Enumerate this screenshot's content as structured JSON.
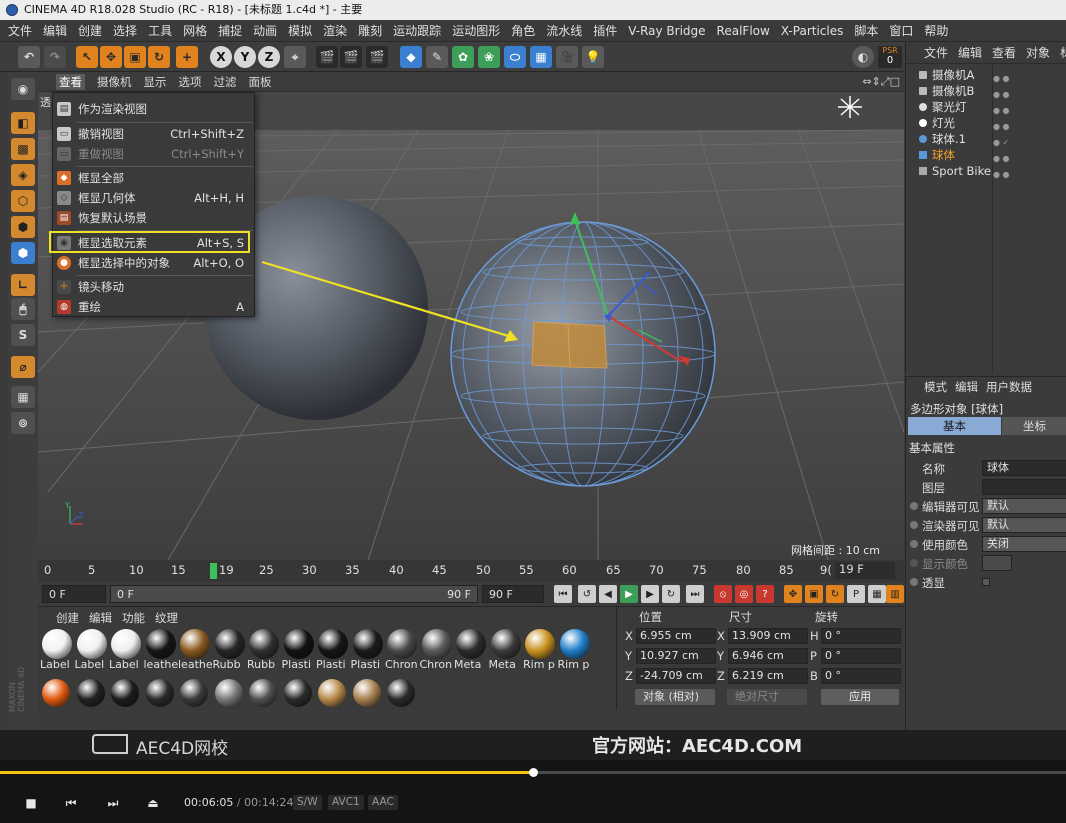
{
  "window": {
    "title": "CINEMA 4D R18.028 Studio (RC - R18) - [未标题 1.c4d *] - 主要"
  },
  "menubar": [
    "文件",
    "编辑",
    "创建",
    "选择",
    "工具",
    "网格",
    "捕捉",
    "动画",
    "模拟",
    "渲染",
    "雕刻",
    "运动跟踪",
    "运动图形",
    "角色",
    "流水线",
    "插件",
    "V-Ray Bridge",
    "RealFlow",
    "X-Particles",
    "脚本",
    "窗口",
    "帮助"
  ],
  "toolbar": {
    "undo_icon": "undo-icon",
    "psr_label": "PSR",
    "psr_value": "0",
    "x_label": "X",
    "y_label": "Y",
    "z_label": "Z"
  },
  "viewport": {
    "menu": [
      "查看",
      "摄像机",
      "显示",
      "选项",
      "过滤",
      "面板"
    ],
    "mode_label": "透",
    "grid_spacing": "网格间距 : 10 cm",
    "nav_icons": "⇔⇕⤢□"
  },
  "view_menu": {
    "items": [
      {
        "label": "作为渲染视图",
        "shortcut": "",
        "icon": "render-view-icon",
        "disabled": false
      },
      {
        "label": "撤销视图",
        "shortcut": "Ctrl+Shift+Z",
        "icon": "undo-view-icon",
        "disabled": false
      },
      {
        "label": "重做视图",
        "shortcut": "Ctrl+Shift+Y",
        "icon": "redo-view-icon",
        "disabled": true
      },
      {
        "label": "框显全部",
        "shortcut": "",
        "icon": "frame-all-icon",
        "disabled": false
      },
      {
        "label": "框显几何体",
        "shortcut": "Alt+H, H",
        "icon": "frame-geometry-icon",
        "disabled": false
      },
      {
        "label": "恢复默认场景",
        "shortcut": "",
        "icon": "restore-scene-icon",
        "disabled": false
      },
      {
        "label": "框显选取元素",
        "shortcut": "Alt+S, S",
        "icon": "frame-selected-elements-icon",
        "disabled": false
      },
      {
        "label": "框显选择中的对象",
        "shortcut": "Alt+O, O",
        "icon": "frame-selected-objects-icon",
        "disabled": false
      },
      {
        "label": "镜头移动",
        "shortcut": "",
        "icon": "camera-move-icon",
        "disabled": false
      },
      {
        "label": "重绘",
        "shortcut": "A",
        "icon": "redraw-icon",
        "disabled": false
      }
    ]
  },
  "timeline": {
    "ticks": [
      "0",
      "5",
      "10",
      "15",
      "25",
      "30",
      "35",
      "40",
      "45",
      "50",
      "55",
      "60",
      "65",
      "70",
      "75",
      "80",
      "85",
      "9("
    ],
    "current_frame": "19",
    "end_field": "19 F"
  },
  "transport": {
    "start_field": "0 F",
    "range_start": "0 F",
    "range_end": "90 F",
    "end_field": "90 F"
  },
  "material_manager": {
    "menu": [
      "创建",
      "编辑",
      "功能",
      "纹理"
    ],
    "materials_row1": [
      {
        "label": "Label",
        "color": "#f2f2f2"
      },
      {
        "label": "Label",
        "color": "#f0f0f0"
      },
      {
        "label": "Label",
        "color": "#eeeeee"
      },
      {
        "label": "leathe",
        "color": "#161616"
      },
      {
        "label": "leathe",
        "color": "#8a5a1e"
      },
      {
        "label": "Rubb",
        "color": "#262626"
      },
      {
        "label": "Rubb",
        "color": "#303030"
      },
      {
        "label": "Plasti",
        "color": "#111111"
      },
      {
        "label": "Plasti",
        "color": "#151515"
      },
      {
        "label": "Plasti",
        "color": "#1a1a1a"
      },
      {
        "label": "Chron",
        "color": "#4a4a4a"
      },
      {
        "label": "Chron",
        "color": "#5a5a5a"
      },
      {
        "label": "Meta",
        "color": "#2c2c2c"
      },
      {
        "label": "Meta",
        "color": "#3a3a3a"
      },
      {
        "label": "Rim p",
        "color": "#c99220"
      },
      {
        "label": "Rim p",
        "color": "#1f7fc9"
      }
    ],
    "materials_row2": [
      "#e05a10",
      "#222222",
      "#1c1c1c",
      "#2a2a2a",
      "#3a3a3a",
      "#7a7a7a",
      "#505050",
      "#2a2a2a",
      "#b88a4a",
      "#a98050",
      "#2a2a2a"
    ]
  },
  "coordinates": {
    "headers": {
      "pos": "位置",
      "size": "尺寸",
      "rot": "旋转"
    },
    "rows": [
      {
        "axis": "X",
        "pos": "6.955 cm",
        "saxis": "X",
        "size": "13.909 cm",
        "raxis": "H",
        "rot": "0 °"
      },
      {
        "axis": "Y",
        "pos": "10.927 cm",
        "saxis": "Y",
        "size": "6.946 cm",
        "raxis": "P",
        "rot": "0 °"
      },
      {
        "axis": "Z",
        "pos": "-24.709 cm",
        "saxis": "Z",
        "size": "6.219 cm",
        "raxis": "B",
        "rot": "0 °"
      }
    ],
    "mode_dropdown": "对象 (相对)",
    "size_dropdown": "绝对尺寸",
    "apply_label": "应用"
  },
  "object_manager": {
    "menu": [
      "文件",
      "编辑",
      "查看",
      "对象",
      "标"
    ],
    "objects": [
      {
        "name": "摄像机A",
        "selected": false
      },
      {
        "name": "摄像机B",
        "selected": false
      },
      {
        "name": "聚光灯",
        "selected": false
      },
      {
        "name": "灯光",
        "selected": false
      },
      {
        "name": "球体.1",
        "selected": false
      },
      {
        "name": "球体",
        "selected": true
      },
      {
        "name": "Sport Bike",
        "selected": false
      }
    ]
  },
  "attribute_manager": {
    "menu": [
      "模式",
      "编辑",
      "用户数据"
    ],
    "object_label": "多边形对象 [球体]",
    "tabs": {
      "basic": "基本",
      "coord": "坐标"
    },
    "section": "基本属性",
    "rows": [
      {
        "label": "名称",
        "value": "球体"
      },
      {
        "label": "图层",
        "value": ""
      },
      {
        "label": "编辑器可见",
        "value": "默认"
      },
      {
        "label": "渲染器可见",
        "value": "默认"
      },
      {
        "label": "使用颜色",
        "value": "关闭"
      },
      {
        "label": "显示颜色",
        "value": ""
      },
      {
        "label": "透显",
        "value": ""
      }
    ]
  },
  "watermark": {
    "logo": "AEC4D网校",
    "site": "官方网站：AEC4D.COM"
  },
  "player": {
    "time_current": "00:06:05",
    "time_total": "00:14:24",
    "progress": 0.5,
    "badges": [
      "S/W",
      "AVC1",
      "AAC"
    ]
  }
}
